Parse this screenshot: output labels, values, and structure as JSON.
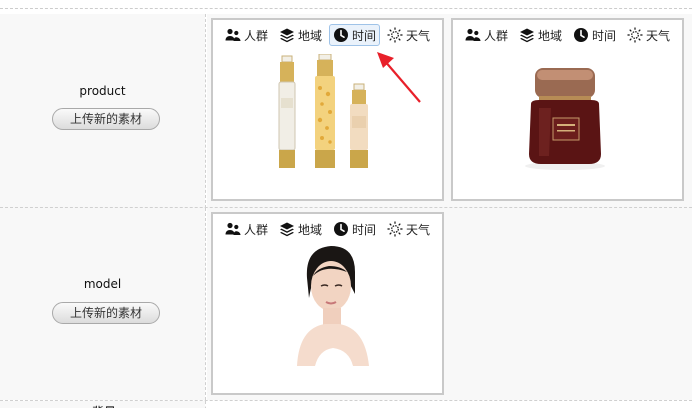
{
  "tags": {
    "people": "人群",
    "region": "地域",
    "time": "时间",
    "weather": "天气"
  },
  "rows": [
    {
      "label": "product",
      "upload_label": "上传新的素材"
    },
    {
      "label": "model",
      "upload_label": "上传新的素材"
    },
    {
      "label": "背景"
    }
  ],
  "cards": {
    "product_1": {
      "image": "cosmetic-bottles-image",
      "highlighted_tag": "time"
    },
    "product_2": {
      "image": "cosmetic-jar-image"
    },
    "model_1": {
      "image": "model-portrait-image"
    }
  },
  "colors": {
    "active_tag_bg": "#eaf2fb",
    "active_tag_border": "#9fc3e8",
    "arrow": "#e8202a",
    "card_border": "#c9c9c9",
    "row_bg": "#f8f8f8"
  }
}
